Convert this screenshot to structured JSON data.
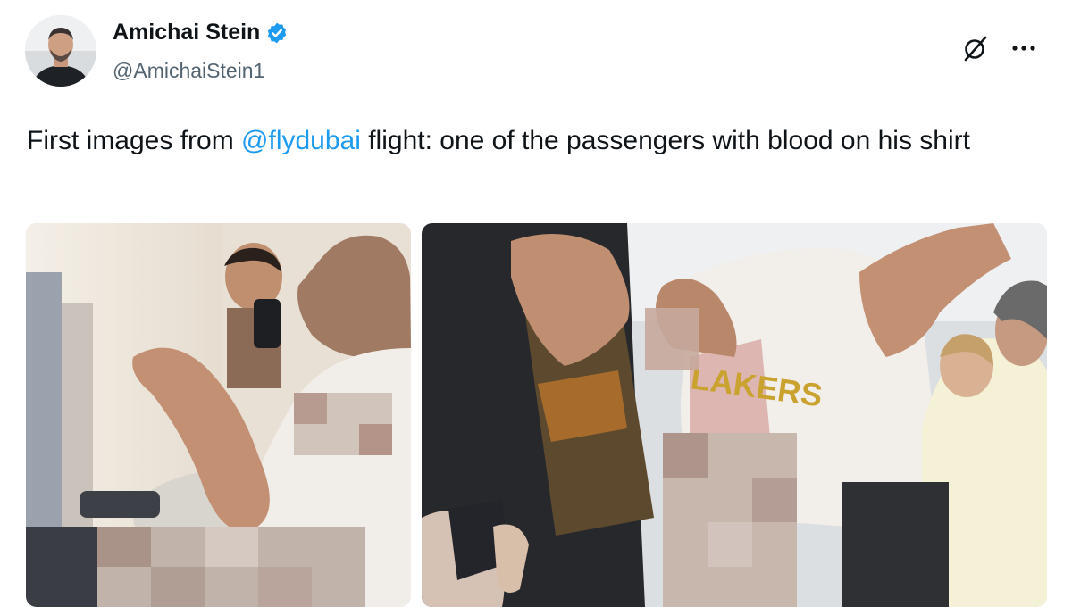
{
  "author": {
    "name": "Amichai Stein",
    "handle": "@AmichaiStein1",
    "verified": true,
    "avatar_icon": "profile-photo"
  },
  "header_actions": {
    "grok_icon": "grok-icon",
    "more_icon": "more-horizontal-icon"
  },
  "tweet": {
    "text_before": "First images from ",
    "mention": "@flydubai",
    "text_after": " flight: one of the passengers with blood on his shirt"
  },
  "media": {
    "count": 2,
    "image_1": "airplane-cabin-photo",
    "image_2": "airplane-aisle-photo"
  },
  "colors": {
    "link": "#1d9bf0",
    "verified": "#1d9bf0",
    "secondary_text": "#536471"
  }
}
